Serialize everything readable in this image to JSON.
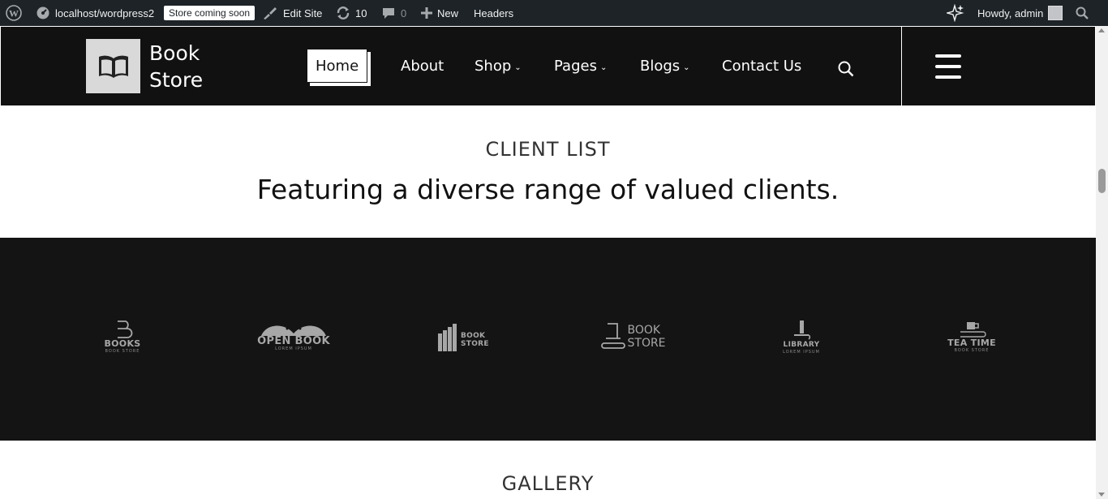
{
  "adminbar": {
    "site_url": "localhost/wordpress2",
    "store_badge": "Store coming soon",
    "edit_site": "Edit Site",
    "updates_count": "10",
    "comments_count": "0",
    "new_label": "New",
    "headers_label": "Headers",
    "howdy": "Howdy, admin"
  },
  "header": {
    "logo_line1": "Book",
    "logo_line2": "Store",
    "nav": {
      "home": "Home",
      "about": "About",
      "shop": "Shop",
      "pages": "Pages",
      "blogs": "Blogs",
      "contact": "Contact Us"
    }
  },
  "clients_section": {
    "subtitle": "CLIENT LIST",
    "heading": "Featuring a diverse range of valued clients.",
    "logos": [
      {
        "name": "BOOKS",
        "tag": "BOOK STORE",
        "icon": "b-letter-icon"
      },
      {
        "name": "OPEN BOOK",
        "tag": "LOREM IPSUM",
        "icon": "open-book-icon"
      },
      {
        "name": "BOOK STORE",
        "tag": "",
        "icon": "bookshelf-icon"
      },
      {
        "name": "BOOK STORE",
        "tag": "",
        "icon": "stacked-books-icon"
      },
      {
        "name": "LIBRARY",
        "tag": "LOREM IPSUM",
        "icon": "book-stand-icon"
      },
      {
        "name": "TEA TIME",
        "tag": "BOOK STORE",
        "icon": "tea-cup-icon"
      }
    ]
  },
  "gallery": {
    "title": "GALLERY"
  },
  "colors": {
    "adminbar_bg": "#1d2327",
    "header_bg": "#111111",
    "clients_bg": "#141414",
    "logo_gray": "#a7a7a7"
  }
}
